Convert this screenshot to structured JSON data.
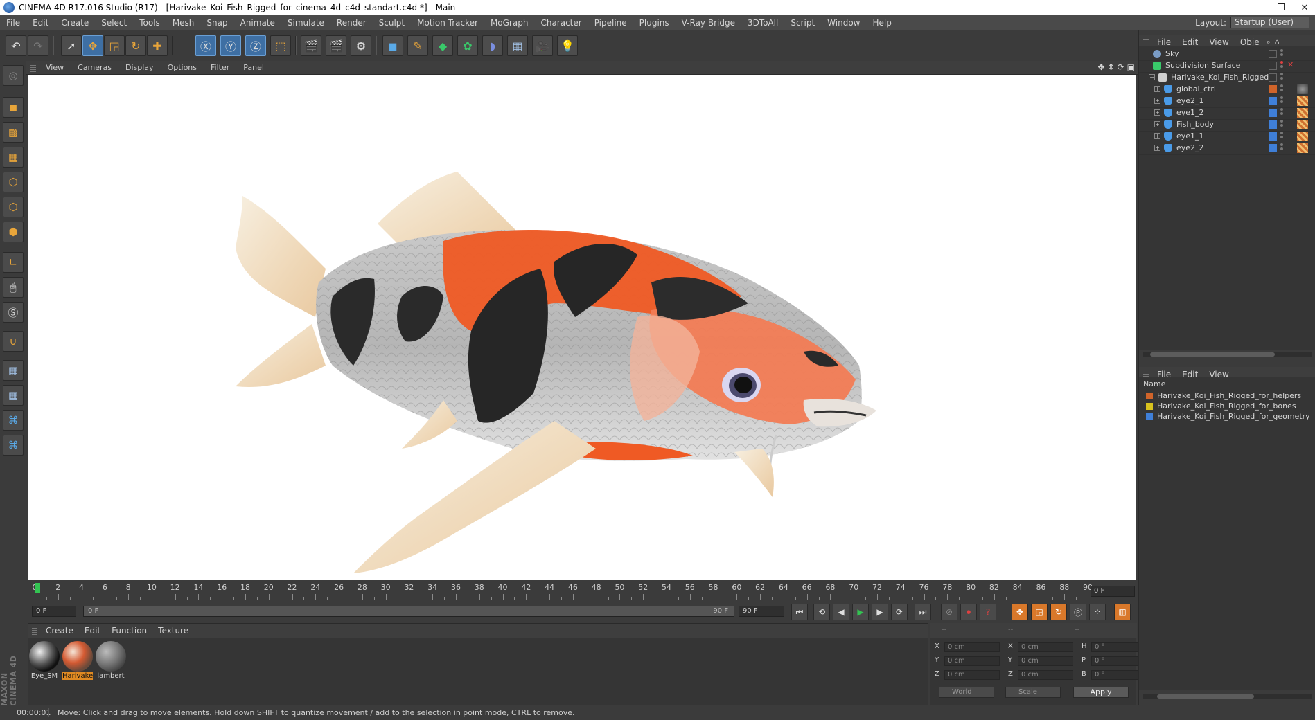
{
  "window": {
    "title": "CINEMA 4D R17.016 Studio (R17) - [Harivake_Koi_Fish_Rigged_for_cinema_4d_c4d_standart.c4d *] - Main",
    "minimize": "—",
    "restore": "❐",
    "close": "✕"
  },
  "menubar": {
    "items": [
      "File",
      "Edit",
      "Create",
      "Select",
      "Tools",
      "Mesh",
      "Snap",
      "Animate",
      "Simulate",
      "Render",
      "Sculpt",
      "Motion Tracker",
      "MoGraph",
      "Character",
      "Pipeline",
      "Plugins",
      "V-Ray Bridge",
      "3DToAll",
      "Script",
      "Window",
      "Help"
    ],
    "layout_label": "Layout:",
    "layout_value": "Startup (User)"
  },
  "viewport": {
    "menu": [
      "View",
      "Cameras",
      "Display",
      "Options",
      "Filter",
      "Panel"
    ]
  },
  "timeline": {
    "ticks": [
      "0",
      "2",
      "4",
      "6",
      "8",
      "10",
      "12",
      "14",
      "16",
      "18",
      "20",
      "22",
      "24",
      "26",
      "28",
      "30",
      "32",
      "34",
      "36",
      "38",
      "40",
      "42",
      "44",
      "46",
      "48",
      "50",
      "52",
      "54",
      "56",
      "58",
      "60",
      "62",
      "64",
      "66",
      "68",
      "70",
      "72",
      "74",
      "76",
      "78",
      "80",
      "82",
      "84",
      "86",
      "88",
      "90"
    ],
    "end_field": "0 F",
    "current_frame": 0
  },
  "playback": {
    "start_field": "0 F",
    "slider_left": "0 F",
    "slider_right": "90 F",
    "end_field": "90 F"
  },
  "materials": {
    "menu": [
      "Create",
      "Edit",
      "Function",
      "Texture"
    ],
    "items": [
      {
        "label": "Eye_SM",
        "selected": false
      },
      {
        "label": "Harivake",
        "selected": true
      },
      {
        "label": "lambert",
        "selected": false
      }
    ]
  },
  "coordinates": {
    "header_cols": [
      "--",
      "--",
      "--"
    ],
    "rows": [
      {
        "a": "X",
        "av": "0 cm",
        "b": "X",
        "bv": "0 cm",
        "c": "H",
        "cv": "0 °"
      },
      {
        "a": "Y",
        "av": "0 cm",
        "b": "Y",
        "bv": "0 cm",
        "c": "P",
        "cv": "0 °"
      },
      {
        "a": "Z",
        "av": "0 cm",
        "b": "Z",
        "bv": "0 cm",
        "c": "B",
        "cv": "0 °"
      }
    ],
    "mode_world": "World",
    "mode_scale": "Scale",
    "apply": "Apply"
  },
  "status": {
    "time": "00:00:01",
    "message": "Move: Click and drag to move elements. Hold down SHIFT to quantize movement / add to the selection in point mode, CTRL to remove."
  },
  "object_manager": {
    "menu": [
      "File",
      "Edit",
      "View",
      "Obje"
    ],
    "objects": [
      {
        "name": "Sky",
        "indent": 0,
        "icon": "sky-icon",
        "color": "#7a9cc6"
      },
      {
        "name": "Subdivision Surface",
        "indent": 0,
        "icon": "subdivision-icon",
        "color": "#39c96a"
      },
      {
        "name": "Harivake_Koi_Fish_Rigged",
        "indent": 1,
        "icon": "null-icon",
        "color": "#cfcfcf"
      },
      {
        "name": "global_ctrl",
        "indent": 2,
        "icon": "joint-icon",
        "color": "#4a9be8"
      },
      {
        "name": "eye2_1",
        "indent": 2,
        "icon": "joint-icon",
        "color": "#4a9be8"
      },
      {
        "name": "eye1_2",
        "indent": 2,
        "icon": "joint-icon",
        "color": "#4a9be8"
      },
      {
        "name": "Fish_body",
        "indent": 2,
        "icon": "joint-icon",
        "color": "#4a9be8"
      },
      {
        "name": "eye1_1",
        "indent": 2,
        "icon": "joint-icon",
        "color": "#4a9be8"
      },
      {
        "name": "eye2_2",
        "indent": 2,
        "icon": "joint-icon",
        "color": "#4a9be8"
      }
    ]
  },
  "layer_manager": {
    "menu": [
      "File",
      "Edit",
      "View"
    ],
    "column": "Name",
    "layers": [
      {
        "name": "Harivake_Koi_Fish_Rigged_for_helpers",
        "color": "#d0642a"
      },
      {
        "name": "Harivake_Koi_Fish_Rigged_for_bones",
        "color": "#d8c21e"
      },
      {
        "name": "Harivake_Koi_Fish_Rigged_for_geometry",
        "color": "#3f7fd8"
      }
    ]
  },
  "colors": {
    "accent_active": "#3e6fa3",
    "selection_orange": "#e08a22",
    "timeline_cursor": "#33c452"
  }
}
